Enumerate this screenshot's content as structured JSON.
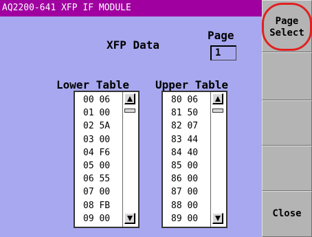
{
  "window": {
    "title": "AQ2200-641 XFP IF MODULE"
  },
  "main": {
    "heading": "XFP Data",
    "page_label": "Page",
    "page_value": "1",
    "lower_table": {
      "title": "Lower Table",
      "rows": [
        "00 06",
        "01 00",
        "02 5A",
        "03 00",
        "04 F6",
        "05 00",
        "06 55",
        "07 00",
        "08 FB",
        "09 00"
      ]
    },
    "upper_table": {
      "title": "Upper Table",
      "rows": [
        "80 06",
        "81 50",
        "82 07",
        "83 44",
        "84 40",
        "85 00",
        "86 00",
        "87 00",
        "88 00",
        "89 00"
      ]
    }
  },
  "sidebar": {
    "page_select_line1": "Page",
    "page_select_line2": "Select",
    "close_label": "Close"
  },
  "colors": {
    "titlebar": "#a000a0",
    "panel": "#a8a8f0",
    "highlight_circle": "#e02020"
  }
}
